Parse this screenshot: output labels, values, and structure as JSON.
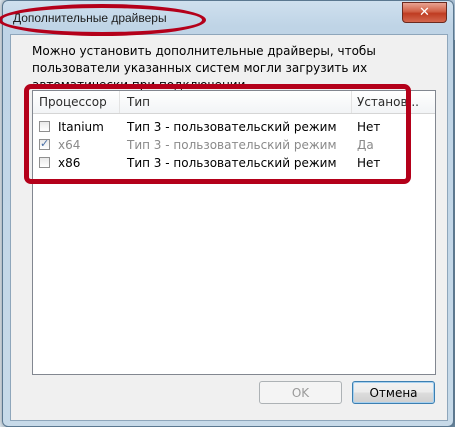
{
  "window": {
    "title": "Дополнительные драйверы",
    "close_glyph": "✕"
  },
  "description": "Можно установить дополнительные драйверы, чтобы пользователи указанных систем могли загрузить их автоматически при подключении.",
  "list": {
    "columns": [
      "Процессор",
      "Тип",
      "Установ..."
    ],
    "rows": [
      {
        "processor": "Itanium",
        "type": "Тип 3 - пользовательский режим",
        "installed": "Нет",
        "checked": false,
        "disabled": false
      },
      {
        "processor": "x64",
        "type": "Тип 3 - пользовательский режим",
        "installed": "Да",
        "checked": true,
        "disabled": true
      },
      {
        "processor": "x86",
        "type": "Тип 3 - пользовательский режим",
        "installed": "Нет",
        "checked": false,
        "disabled": false
      }
    ]
  },
  "buttons": {
    "ok": "OK",
    "cancel": "Отмена"
  },
  "colors": {
    "annotation_red": "#b4001a",
    "close_red": "#c94a30"
  }
}
